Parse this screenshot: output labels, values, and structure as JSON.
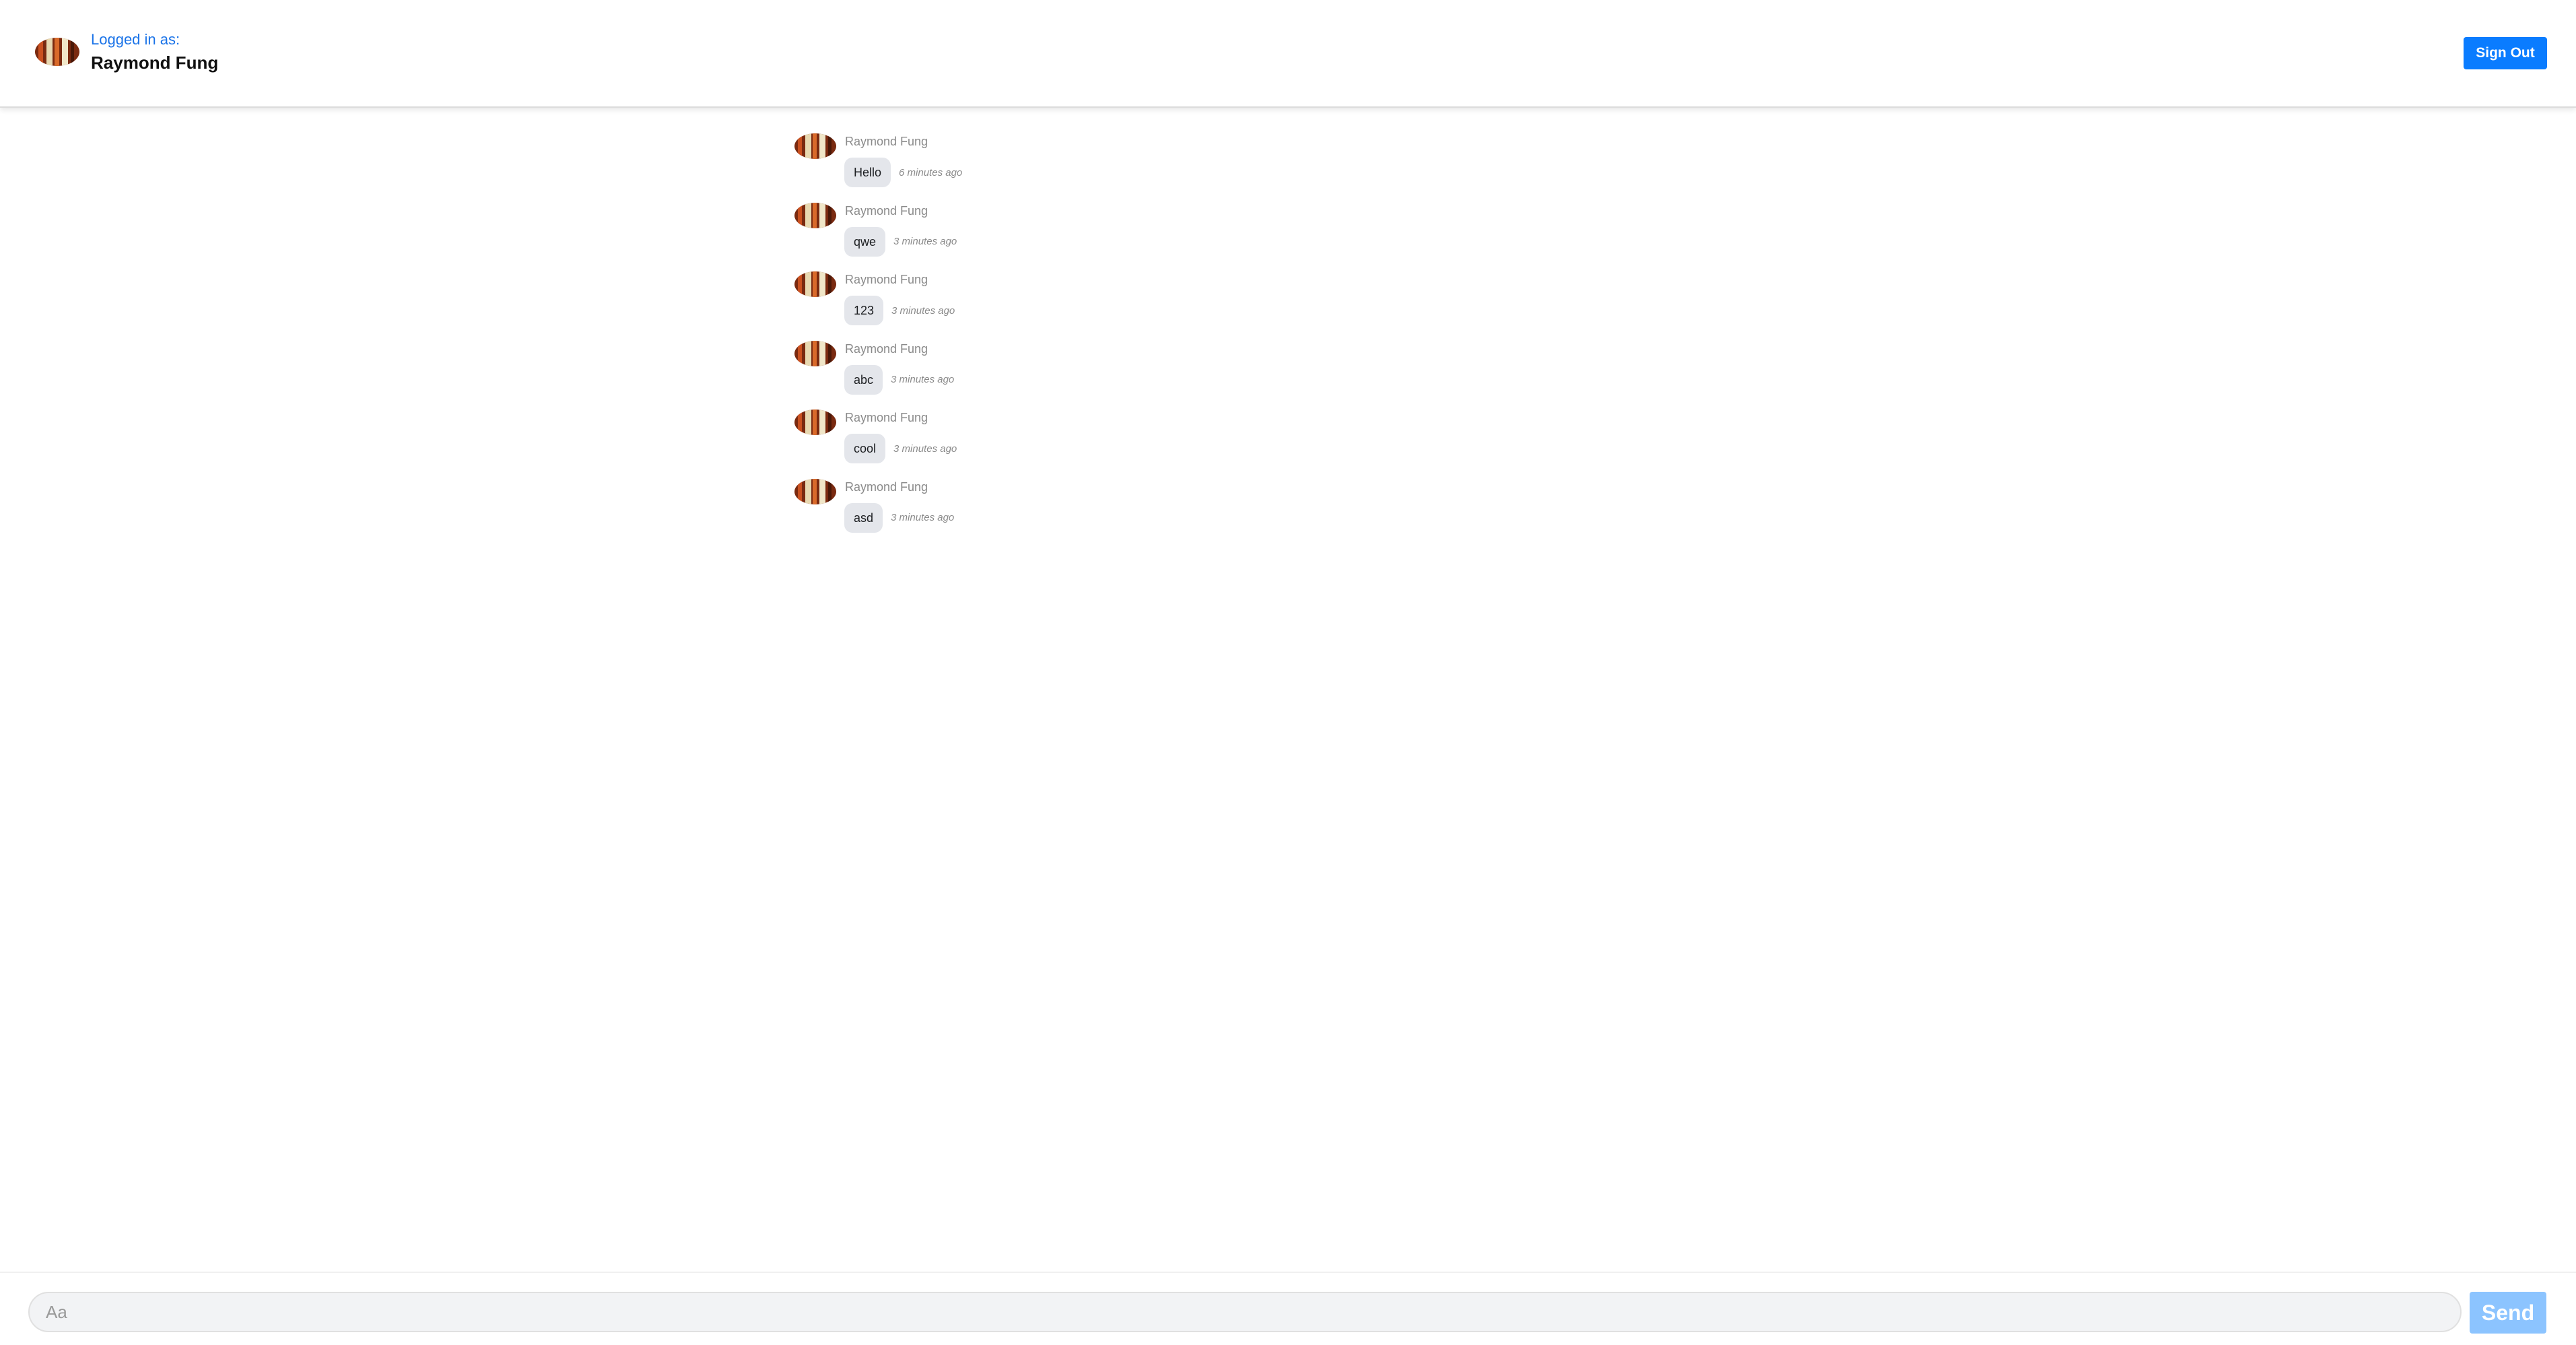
{
  "header": {
    "logged_in_label": "Logged in as:",
    "user_name": "Raymond Fung",
    "sign_out_label": "Sign Out"
  },
  "messages": [
    {
      "sender": "Raymond Fung",
      "text": "Hello",
      "time": "6 minutes ago"
    },
    {
      "sender": "Raymond Fung",
      "text": "qwe",
      "time": "3 minutes ago"
    },
    {
      "sender": "Raymond Fung",
      "text": "123",
      "time": "3 minutes ago"
    },
    {
      "sender": "Raymond Fung",
      "text": "abc",
      "time": "3 minutes ago"
    },
    {
      "sender": "Raymond Fung",
      "text": "cool",
      "time": "3 minutes ago"
    },
    {
      "sender": "Raymond Fung",
      "text": "asd",
      "time": "3 minutes ago"
    }
  ],
  "composer": {
    "placeholder": "Aa",
    "value": "",
    "send_label": "Send"
  },
  "colors": {
    "accent": "#0a7cff",
    "send_disabled": "#8cc4ff",
    "bubble": "#e4e6eb",
    "link": "#1a73e8"
  },
  "icons": {
    "user_avatar": "user-avatar-photo"
  }
}
